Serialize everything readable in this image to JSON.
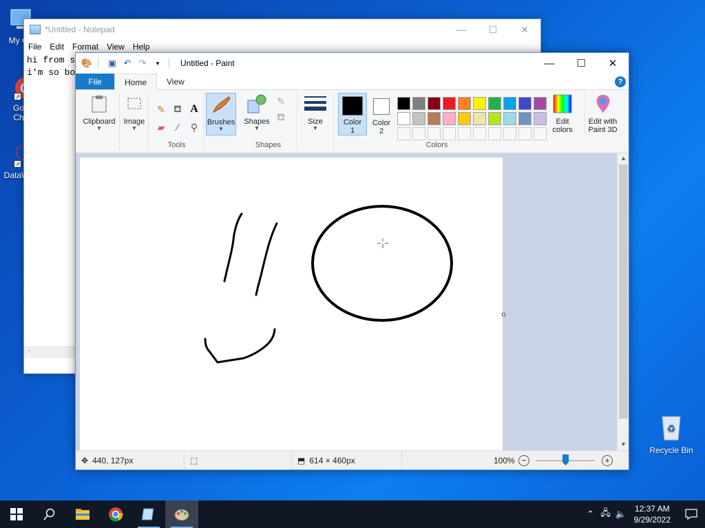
{
  "desktop": {
    "icons": [
      {
        "label": "My Co"
      },
      {
        "label": "Go Ch"
      },
      {
        "label": "DataW"
      }
    ],
    "recycle_bin": "Recycle Bin"
  },
  "notepad": {
    "title": "*Untitled - Notepad",
    "menu": [
      "File",
      "Edit",
      "Format",
      "View",
      "Help"
    ],
    "text_lines": [
      "hi from s",
      "i'm so bo"
    ]
  },
  "paint": {
    "title": "Untitled - Paint",
    "tabs": {
      "file": "File",
      "home": "Home",
      "view": "View"
    },
    "ribbon": {
      "clipboard": "Clipboard",
      "image": "Image",
      "tools_group": "Tools",
      "brushes": "Brushes",
      "shapes": "Shapes",
      "shapes_group": "Shapes",
      "size": "Size",
      "color1": "Color",
      "color1_num": "1",
      "color2": "Color",
      "color2_num": "2",
      "colors_group": "Colors",
      "edit_colors_1": "Edit",
      "edit_colors_2": "colors",
      "edit_paint3d_1": "Edit with",
      "edit_paint3d_2": "Paint 3D"
    },
    "palette_row1": [
      "#000000",
      "#7f7f7f",
      "#880015",
      "#ed1c24",
      "#ff7f27",
      "#fff200",
      "#22b14c",
      "#00a2e8",
      "#3f48cc",
      "#a349a4"
    ],
    "palette_row2": [
      "#ffffff",
      "#c3c3c3",
      "#b97a57",
      "#ffaec9",
      "#ffc90e",
      "#efe4b0",
      "#b5e61d",
      "#99d9ea",
      "#7092be",
      "#c8bfe7"
    ],
    "color1_value": "#000000",
    "color2_value": "#ffffff",
    "status": {
      "cursor_pos": "440, 127px",
      "canvas_size": "614 × 460px",
      "zoom": "100%"
    }
  },
  "taskbar": {
    "time": "12:37 AM",
    "date": "9/29/2022"
  }
}
